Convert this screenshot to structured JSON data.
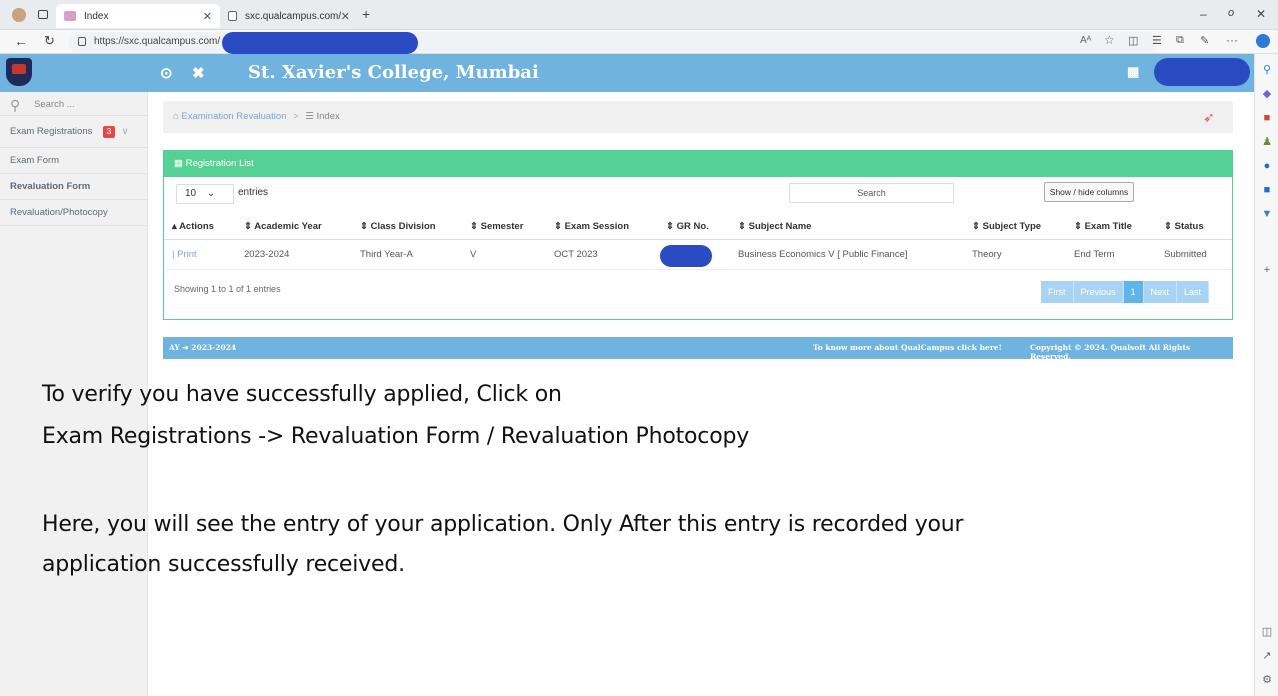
{
  "browser": {
    "tabs": [
      {
        "label": "Index"
      },
      {
        "label": "sxc.qualcampus.com/Report_Vie"
      }
    ],
    "url": "https://sxc.qualcampus.com/",
    "icons": [
      "profile-icon",
      "tab-actions-icon",
      "back-icon",
      "refresh-icon",
      "lock-icon",
      "read-aloud-icon",
      "favorite-icon",
      "split-screen-icon",
      "favorites-bar-icon",
      "collections-icon",
      "extensions-icon",
      "more-icon",
      "copilot-icon"
    ]
  },
  "header": {
    "title": "St. Xavier's College, Mumbai"
  },
  "sidebar": {
    "search_placeholder": "Search ...",
    "items": [
      {
        "label": "Exam Registrations",
        "badge": "3"
      },
      {
        "label": "Exam Form"
      },
      {
        "label": "Revaluation Form"
      },
      {
        "label": "Revaluation/Photocopy"
      }
    ]
  },
  "breadcrumb": {
    "parent": "Examination Revaluation",
    "separator": ">",
    "current": "Index"
  },
  "panel": {
    "title": "Registration List",
    "entries_value": "10",
    "entries_label": "entries",
    "search_placeholder": "Search",
    "show_hide_label": "Show / hide columns",
    "columns": [
      "Actions",
      "Academic Year",
      "Class Division",
      "Semester",
      "Exam Session",
      "GR No.",
      "Subject Name",
      "Subject Type",
      "Exam Title",
      "Status"
    ],
    "rows": [
      {
        "actions": "| Print",
        "academic_year": "2023-2024",
        "class_division": "Third Year-A",
        "semester": "V",
        "exam_session": "OCT 2023",
        "gr_no": "",
        "subject_name": "Business Economics V [ Public Finance]",
        "subject_type": "Theory",
        "exam_title": "End Term",
        "status": "Submitted"
      }
    ],
    "showing_text": "Showing 1 to 1 of 1 entries",
    "pager": [
      "First",
      "Previous",
      "1",
      "Next",
      "Last"
    ]
  },
  "footer": {
    "left": "AY ➜ 2023-2024",
    "more": "To know more about QualCampus click here!",
    "copyright": "Copyright © 2024. Qualsoft All Rights Reserved."
  },
  "instructions": {
    "line1": "To verify you have successfully applied, Click on",
    "line2": "Exam Registrations -> Revaluation Form / Revaluation Photocopy",
    "line3": "Here, you will see the entry of your application. Only After this entry is recorded your",
    "line4": "application successfully received."
  },
  "colors": {
    "header_blue": "#6fb3de",
    "panel_green": "#56d195",
    "redaction_blue": "#2b4bc2",
    "badge_red": "#e24a4a"
  }
}
